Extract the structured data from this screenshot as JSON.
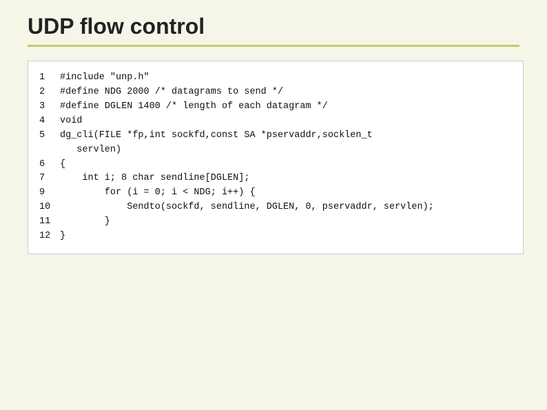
{
  "title": "UDP flow control",
  "code": {
    "lines": [
      {
        "num": "1",
        "content": "#include \"unp.h\""
      },
      {
        "num": "2",
        "content": "#define NDG 2000 /* datagrams to send */"
      },
      {
        "num": "3",
        "content": "#define DGLEN 1400 /* length of each datagram */"
      },
      {
        "num": "4",
        "content": "void"
      },
      {
        "num": "5",
        "content": "dg_cli(FILE *fp,int sockfd,const SA *pservaddr,socklen_t"
      },
      {
        "num": "",
        "content": "   servlen)"
      },
      {
        "num": "6",
        "content": "{"
      },
      {
        "num": "7",
        "content": "    int i; 8 char sendline[DGLEN];"
      },
      {
        "num": "9",
        "content": "        for (i = 0; i < NDG; i++) {"
      },
      {
        "num": "10",
        "content": "            Sendto(sockfd, sendline, DGLEN, 0, pservaddr, servlen);"
      },
      {
        "num": "11",
        "content": "        }"
      },
      {
        "num": "12",
        "content": "}"
      }
    ]
  }
}
